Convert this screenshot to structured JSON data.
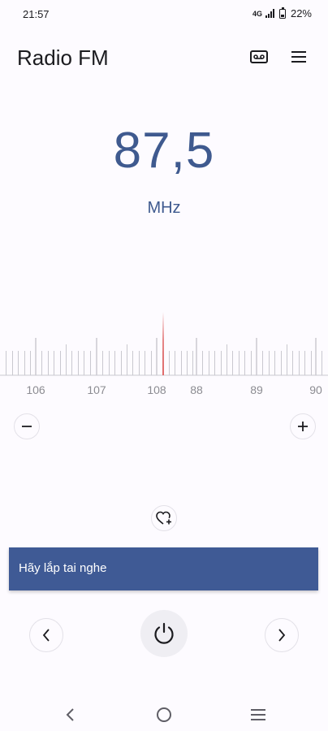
{
  "status_bar": {
    "time": "21:57",
    "network": "4G",
    "battery": "22%"
  },
  "header": {
    "title": "Radio FM",
    "record_icon": "cassette-icon",
    "menu_icon": "hamburger-menu-icon"
  },
  "tuner": {
    "frequency": "87,5",
    "unit": "MHz",
    "scale_labels": [
      "106",
      "107",
      "108",
      "88",
      "89",
      "90"
    ]
  },
  "controls": {
    "step_down_icon": "minus-icon",
    "step_up_icon": "plus-icon",
    "favorite_icon": "heart-add-icon",
    "previous_icon": "chevron-left-icon",
    "power_icon": "power-icon",
    "next_icon": "chevron-right-icon"
  },
  "toast": {
    "message": "Hãy lắp tai nghe"
  },
  "system_nav": {
    "back_icon": "back-icon",
    "home_icon": "home-icon",
    "recents_icon": "recents-icon"
  },
  "colors": {
    "accent": "#3f5a8f",
    "toast_background": "#3f5a95",
    "needle": "#e06a6a",
    "background": "#fdfbff"
  }
}
